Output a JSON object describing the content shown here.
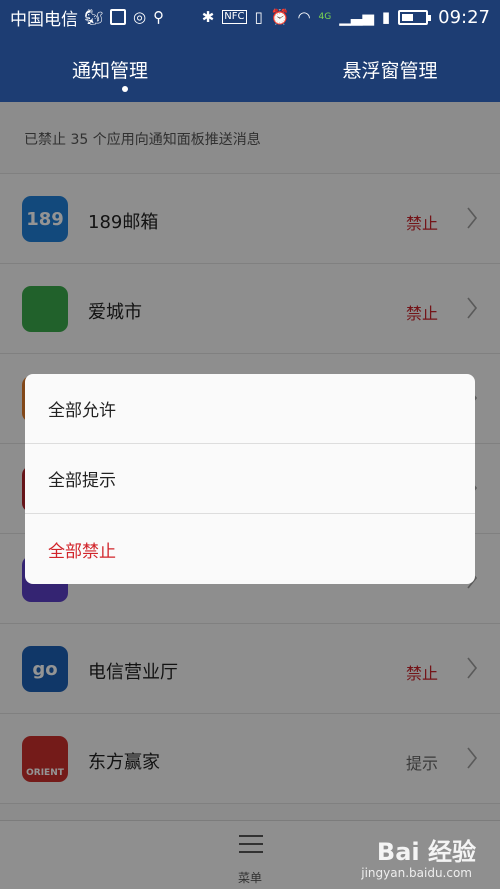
{
  "status_bar": {
    "carrier": "中国电信",
    "time": "09:27",
    "network_badge": "4G",
    "nfc_label": "NFC",
    "battery_level": 0.5,
    "icons": [
      "uc-browser-icon",
      "gallery-icon",
      "app-icon",
      "search-icon",
      "bluetooth-icon",
      "nfc-icon",
      "vibrate-icon",
      "alarm-icon",
      "wifi-icon",
      "signal-icon",
      "sim-icon",
      "battery-icon"
    ]
  },
  "tabs": [
    {
      "label": "通知管理",
      "active": true
    },
    {
      "label": "悬浮窗管理",
      "active": false
    }
  ],
  "summary": "已禁止 35 个应用向通知面板推送消息",
  "apps": [
    {
      "name": "189邮箱",
      "status": "禁止",
      "status_color": "#c8232a",
      "icon_color": "#1f7fd6",
      "icon_text": "189"
    },
    {
      "name": "爱城市",
      "status": "禁止",
      "status_color": "#c8232a",
      "icon_color": "#3aa84a",
      "icon_text": ""
    },
    {
      "name": "",
      "status": "",
      "status_color": "#c8232a",
      "icon_color": "#e07a2a",
      "icon_text": ""
    },
    {
      "name": "",
      "status": "",
      "status_color": "#c8232a",
      "icon_color": "#b0222a",
      "icon_text": ""
    },
    {
      "name": "",
      "status": "",
      "status_color": "#c8232a",
      "icon_color": "#5b3fc4",
      "icon_text": ""
    },
    {
      "name": "电信营业厅",
      "status": "禁止",
      "status_color": "#c8232a",
      "icon_color": "#1d5fb4",
      "icon_text": "go"
    },
    {
      "name": "东方赢家",
      "status": "提示",
      "status_color": "#666666",
      "icon_color": "#c9302c",
      "icon_text": "ORIENT"
    }
  ],
  "bottom_menu": {
    "label": "菜单"
  },
  "dialog": {
    "options": [
      {
        "label": "全部允许",
        "danger": false
      },
      {
        "label": "全部提示",
        "danger": false
      },
      {
        "label": "全部禁止",
        "danger": true
      }
    ]
  },
  "watermark": {
    "brand": "Bai 经验",
    "sub": "jingyan.baidu.com"
  },
  "colors": {
    "header": "#1d3d73",
    "danger": "#d1242a"
  }
}
